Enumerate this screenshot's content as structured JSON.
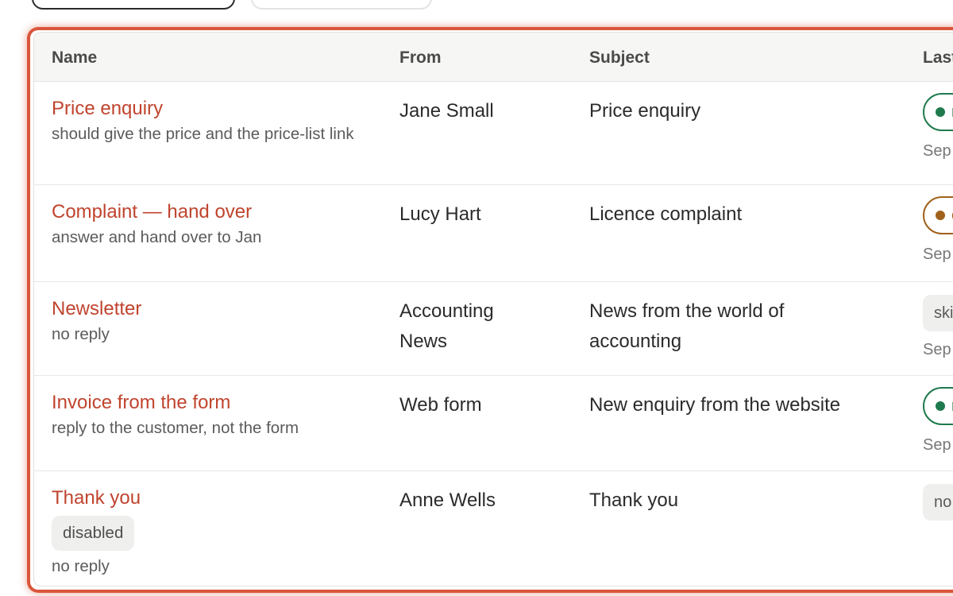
{
  "table": {
    "headers": {
      "name": "Name",
      "from": "From",
      "subject": "Subject",
      "last": "Last"
    },
    "rows": [
      {
        "name": "Price enquiry",
        "note": "should give the price and the price-list link",
        "from": "Jane Small",
        "subject": "Price enquiry",
        "status": {
          "kind": "pill",
          "color": "green",
          "text": "r"
        },
        "date": "Sep"
      },
      {
        "name": "Complaint — hand over",
        "note": "answer and hand over to Jan",
        "from": "Lucy Hart",
        "subject": "Licence complaint",
        "status": {
          "kind": "pill",
          "color": "amber",
          "text": "c"
        },
        "date": "Sep"
      },
      {
        "name": "Newsletter",
        "note": "no reply",
        "from": "Accounting News",
        "subject": "News from the world of accounting",
        "status": {
          "kind": "tag",
          "text": "ski"
        },
        "date": "Sep"
      },
      {
        "name": "Invoice from the form",
        "note": "reply to the customer, not the form",
        "from": "Web form",
        "subject": "New enquiry from the website",
        "status": {
          "kind": "pill",
          "color": "green",
          "text": "r"
        },
        "date": "Sep"
      },
      {
        "name": "Thank you",
        "badge": "disabled",
        "note": "no reply",
        "from": "Anne Wells",
        "subject": "Thank you",
        "status": {
          "kind": "tag",
          "text": "no"
        },
        "date": ""
      }
    ]
  },
  "colors": {
    "accent": "#d9563b",
    "rule_name": "#c0442e",
    "status_green": "#1f7a4d",
    "status_amber": "#a0611b"
  }
}
